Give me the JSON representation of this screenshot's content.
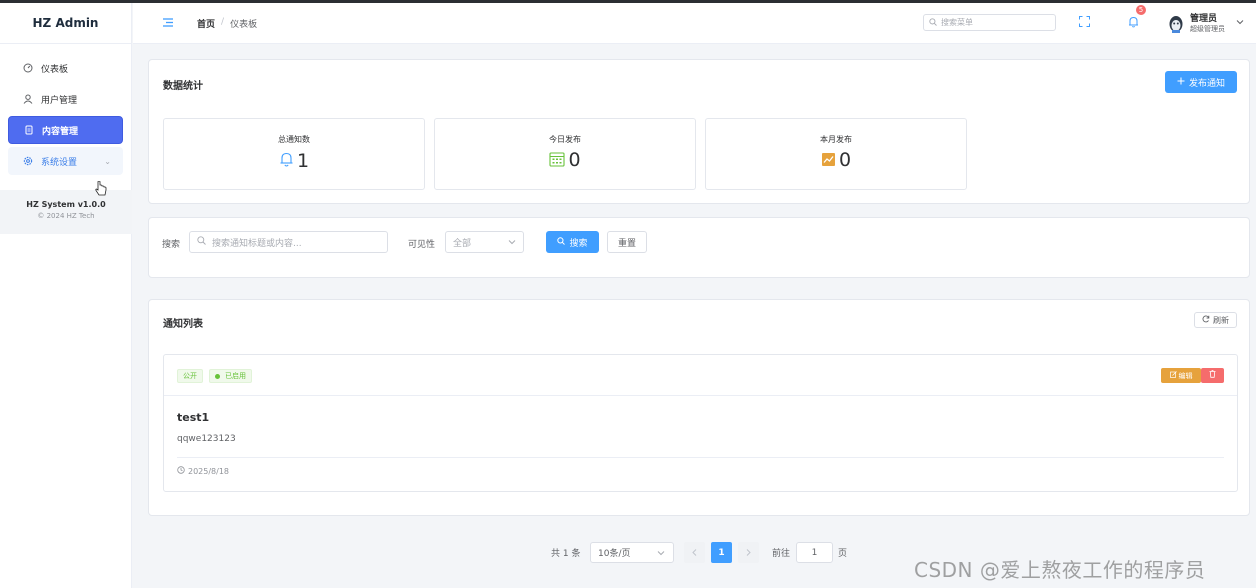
{
  "app": {
    "brand": "HZ Admin"
  },
  "sidebar": {
    "items": [
      {
        "label": "仪表板",
        "icon": "dashboard-icon"
      },
      {
        "label": "用户管理",
        "icon": "user-icon"
      },
      {
        "label": "内容管理",
        "icon": "document-icon",
        "active": true
      },
      {
        "label": "系统设置",
        "icon": "gear-icon",
        "arrow": "⌄"
      }
    ],
    "footer": {
      "version": "HZ System v1.0.0",
      "copyright": "© 2024 HZ Tech"
    }
  },
  "header": {
    "breadcrumb": {
      "home": "首页",
      "separator": "/",
      "current": "仪表板"
    },
    "search_placeholder": "搜索菜单",
    "notification_count": "5",
    "user": {
      "name": "管理员",
      "role": "超级管理员"
    }
  },
  "stats": {
    "title": "数据统计",
    "publish_label": "发布通知",
    "items": [
      {
        "label": "总通知数",
        "value": "1",
        "icon": "bell-icon",
        "color": "#409eff"
      },
      {
        "label": "今日发布",
        "value": "0",
        "icon": "calendar-icon",
        "color": "#67c23a"
      },
      {
        "label": "本月发布",
        "value": "0",
        "icon": "trend-chart-icon",
        "color": "#e6a23c"
      }
    ]
  },
  "filters": {
    "search_label": "搜索",
    "search_placeholder": "搜索通知标题或内容...",
    "visibility_label": "可见性",
    "visibility_value": "全部",
    "search_button": "搜索",
    "reset_button": "重置"
  },
  "list": {
    "title": "通知列表",
    "refresh_label": "刷新",
    "notices": [
      {
        "tag_visibility": "公开",
        "tag_status": "已启用",
        "edit_label": "编辑",
        "title": "test1",
        "content": "qqwe123123",
        "date": "2025/8/18"
      }
    ]
  },
  "pagination": {
    "total": "共 1 条",
    "page_size": "10条/页",
    "current_page": "1",
    "goto_label": "前往",
    "goto_value": "1",
    "goto_suffix": "页"
  },
  "watermark": "CSDN @爱上熬夜工作的程序员",
  "colors": {
    "primary": "#409eff",
    "active_menu": "#4f6cf0",
    "success": "#67c23a",
    "warning": "#e6a23c",
    "danger": "#f56c6c"
  }
}
